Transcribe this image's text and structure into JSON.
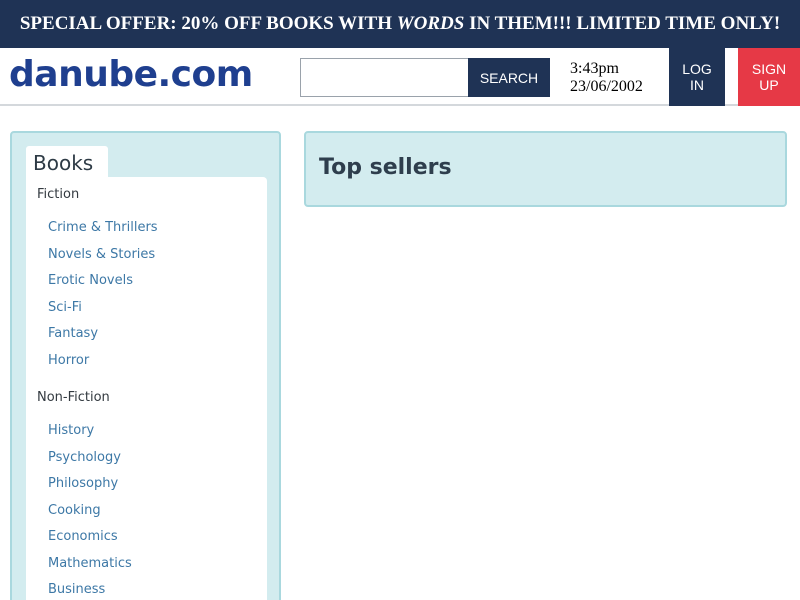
{
  "banner": {
    "text_before": "SPECIAL OFFER: 20% OFF BOOKS WITH ",
    "text_emph": "WORDS",
    "text_after": " IN THEM!!! LIMITED TIME ONLY!"
  },
  "header": {
    "logo": "danube.com",
    "search": {
      "value": "",
      "placeholder": "",
      "button_label": "SEARCH"
    },
    "time": "3:43pm",
    "date": "23/06/2002",
    "login_line1": "LOG",
    "login_line2": "IN",
    "signup_line1": "SIGN",
    "signup_line2": "UP"
  },
  "sidebar": {
    "tab_label": "Books",
    "fiction": {
      "heading": "Fiction",
      "items": [
        "Crime & Thrillers",
        "Novels & Stories",
        "Erotic Novels",
        "Sci-Fi",
        "Fantasy",
        "Horror"
      ]
    },
    "nonfiction": {
      "heading": "Non-Fiction",
      "items": [
        "History",
        "Psychology",
        "Philosophy",
        "Cooking",
        "Economics",
        "Mathematics",
        "Business"
      ]
    }
  },
  "main": {
    "title": "Top sellers"
  },
  "colors": {
    "navy": "#1f3355",
    "red": "#e63946",
    "logo_blue": "#1f3f8f",
    "panel_teal": "#d3ecef",
    "link_blue": "#3d78a6"
  }
}
